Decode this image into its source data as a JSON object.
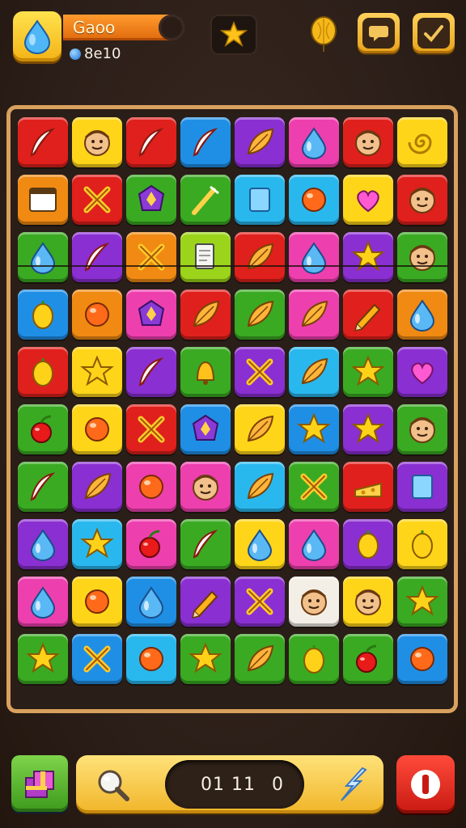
{
  "hud": {
    "player_name": "Gaoo",
    "score": "8e10",
    "icons": [
      "water-drop-icon",
      "star-icon",
      "balloon-icon",
      "chat-icon",
      "check-icon"
    ]
  },
  "board": {
    "rows": 10,
    "cols": 8,
    "tiles": [
      [
        "red",
        "feather"
      ],
      [
        "yellow",
        "face"
      ],
      [
        "red",
        "feather"
      ],
      [
        "blue",
        "feather"
      ],
      [
        "purple",
        "leaf"
      ],
      [
        "pink",
        "drop"
      ],
      [
        "red",
        "face"
      ],
      [
        "yellow",
        "spiral"
      ],
      [
        "orange",
        "window"
      ],
      [
        "red",
        "x"
      ],
      [
        "green",
        "gem"
      ],
      [
        "green",
        "wand"
      ],
      [
        "sky",
        "square"
      ],
      [
        "sky",
        "orb"
      ],
      [
        "yellow",
        "heart"
      ],
      [
        "red",
        "face"
      ],
      [
        "green",
        "drop"
      ],
      [
        "purple",
        "feather"
      ],
      [
        "orange",
        "x"
      ],
      [
        "lime",
        "page"
      ],
      [
        "red",
        "leaf"
      ],
      [
        "pink",
        "drop"
      ],
      [
        "purple",
        "star"
      ],
      [
        "green",
        "face"
      ],
      [
        "blue",
        "lemon"
      ],
      [
        "orange",
        "orb"
      ],
      [
        "pink",
        "gem"
      ],
      [
        "red",
        "leaf"
      ],
      [
        "green",
        "leaf"
      ],
      [
        "pink",
        "leaf"
      ],
      [
        "red",
        "pencil"
      ],
      [
        "orange",
        "drop"
      ],
      [
        "red",
        "lemon"
      ],
      [
        "yellow",
        "star"
      ],
      [
        "purple",
        "feather"
      ],
      [
        "green",
        "bell"
      ],
      [
        "purple",
        "x"
      ],
      [
        "sky",
        "leaf"
      ],
      [
        "green",
        "star"
      ],
      [
        "purple",
        "heart"
      ],
      [
        "green",
        "cherry"
      ],
      [
        "yellow",
        "orb"
      ],
      [
        "red",
        "x"
      ],
      [
        "blue",
        "gem"
      ],
      [
        "yellow",
        "leaf"
      ],
      [
        "blue",
        "star"
      ],
      [
        "purple",
        "star"
      ],
      [
        "green",
        "face"
      ],
      [
        "green",
        "feather"
      ],
      [
        "purple",
        "leaf"
      ],
      [
        "pink",
        "orb"
      ],
      [
        "pink",
        "face"
      ],
      [
        "sky",
        "leaf"
      ],
      [
        "green",
        "x"
      ],
      [
        "red",
        "cheese"
      ],
      [
        "purple",
        "square"
      ],
      [
        "purple",
        "drop"
      ],
      [
        "sky",
        "star"
      ],
      [
        "pink",
        "cherry"
      ],
      [
        "green",
        "feather"
      ],
      [
        "yellow",
        "drop"
      ],
      [
        "pink",
        "drop"
      ],
      [
        "purple",
        "lemon"
      ],
      [
        "yellow",
        "lemon"
      ],
      [
        "pink",
        "drop"
      ],
      [
        "yellow",
        "orb"
      ],
      [
        "blue",
        "drop"
      ],
      [
        "purple",
        "pencil"
      ],
      [
        "purple",
        "x"
      ],
      [
        "white",
        "face"
      ],
      [
        "yellow",
        "face"
      ],
      [
        "green",
        "star"
      ],
      [
        "green",
        "star"
      ],
      [
        "blue",
        "x"
      ],
      [
        "sky",
        "orb"
      ],
      [
        "green",
        "star"
      ],
      [
        "green",
        "leaf"
      ],
      [
        "green",
        "lemon"
      ],
      [
        "green",
        "cherry"
      ],
      [
        "blue",
        "orb"
      ]
    ]
  },
  "controls": {
    "timer": "01 11",
    "counter": "0"
  },
  "colors": {
    "red": "#e0201c",
    "yellow": "#ffd51a",
    "blue": "#1f8fe6",
    "purple": "#8a2fd1",
    "pink": "#ee3fae",
    "green": "#3aaa22",
    "orange": "#f08a12",
    "sky": "#29b8ee",
    "lime": "#9bd41a",
    "white": "#f4efe6"
  }
}
